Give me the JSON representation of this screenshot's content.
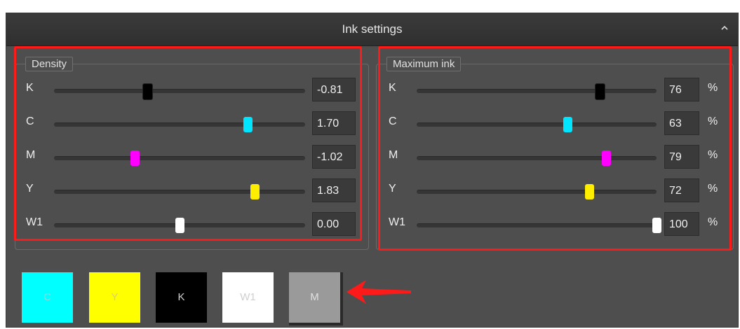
{
  "header": {
    "title": "Ink settings",
    "collapse_icon": "chevron-up-icon"
  },
  "density": {
    "legend": "Density",
    "rows": [
      {
        "label": "K",
        "value": "-0.81",
        "level": 0.37,
        "color": "#000000"
      },
      {
        "label": "C",
        "value": "1.70",
        "level": 0.77,
        "color": "#00e5ff"
      },
      {
        "label": "M",
        "value": "-1.02",
        "level": 0.32,
        "color": "#ff00ff"
      },
      {
        "label": "Y",
        "value": "1.83",
        "level": 0.8,
        "color": "#ffee00"
      },
      {
        "label": "W1",
        "value": "0.00",
        "level": 0.5,
        "color": "#ffffff"
      }
    ]
  },
  "max_ink": {
    "legend": "Maximum ink",
    "unit": "%",
    "rows": [
      {
        "label": "K",
        "value": "76",
        "level": 0.76,
        "color": "#000000"
      },
      {
        "label": "C",
        "value": "63",
        "level": 0.63,
        "color": "#00e5ff"
      },
      {
        "label": "M",
        "value": "79",
        "level": 0.79,
        "color": "#ff00ff"
      },
      {
        "label": "Y",
        "value": "72",
        "level": 0.72,
        "color": "#ffee00"
      },
      {
        "label": "W1",
        "value": "100",
        "level": 1.0,
        "color": "#ffffff"
      }
    ]
  },
  "swatches": [
    {
      "label": "C",
      "bg": "#00ffff",
      "fg": "#8fd8dc"
    },
    {
      "label": "Y",
      "bg": "#ffff00",
      "fg": "#d8d070"
    },
    {
      "label": "K",
      "bg": "#000000",
      "fg": "#d0d0d0"
    },
    {
      "label": "W1",
      "bg": "#ffffff",
      "fg": "#cfcfcf"
    },
    {
      "label": "M",
      "bg": "#9a9a9a",
      "fg": "#e0e0e0"
    }
  ],
  "annotation": {
    "highlight_color": "#ff1a1a",
    "arrow_icon": "left-arrow-icon"
  }
}
